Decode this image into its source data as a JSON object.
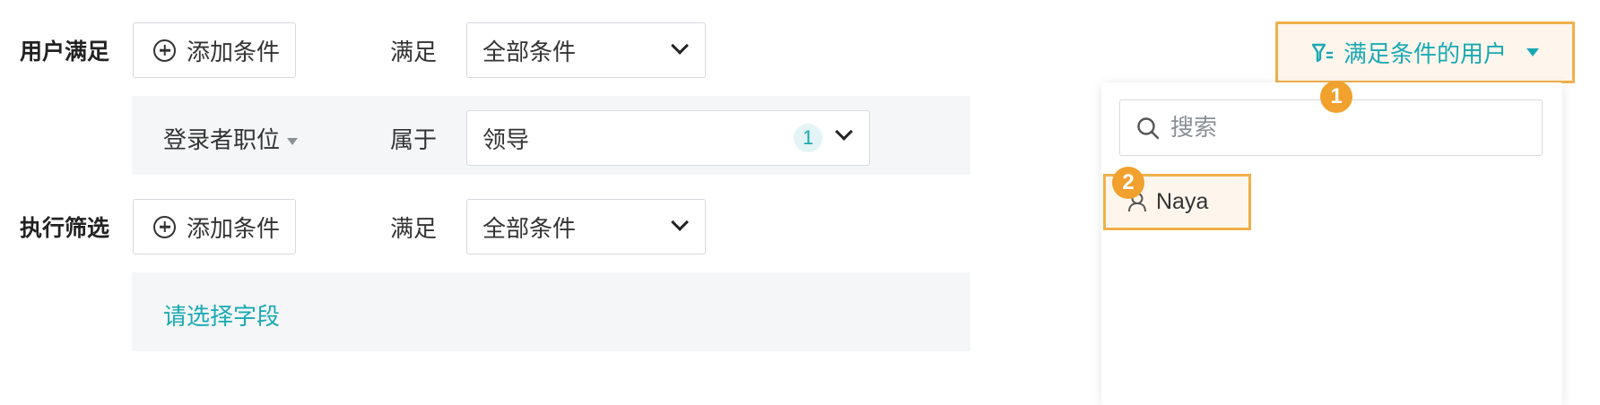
{
  "user_match": {
    "label": "用户满足",
    "add_condition": "添加条件",
    "satisfy_label": "满足",
    "satisfy_select": "全部条件",
    "condition": {
      "field": "登录者职位",
      "operator": "属于",
      "value": "领导",
      "value_count": "1"
    }
  },
  "exec_filter": {
    "label": "执行筛选",
    "add_condition": "添加条件",
    "satisfy_label": "满足",
    "satisfy_select": "全部条件",
    "field_placeholder": "请选择字段"
  },
  "filter_button": {
    "label": "满足条件的用户"
  },
  "user_dropdown": {
    "search_placeholder": "搜索",
    "users": [
      "Naya"
    ]
  },
  "step_badges": [
    "1",
    "2"
  ],
  "colors": {
    "accent": "#19a9b3",
    "highlight_border": "#f0b04a",
    "highlight_fill": "#fef6ec",
    "step_badge": "#f0a12e"
  }
}
